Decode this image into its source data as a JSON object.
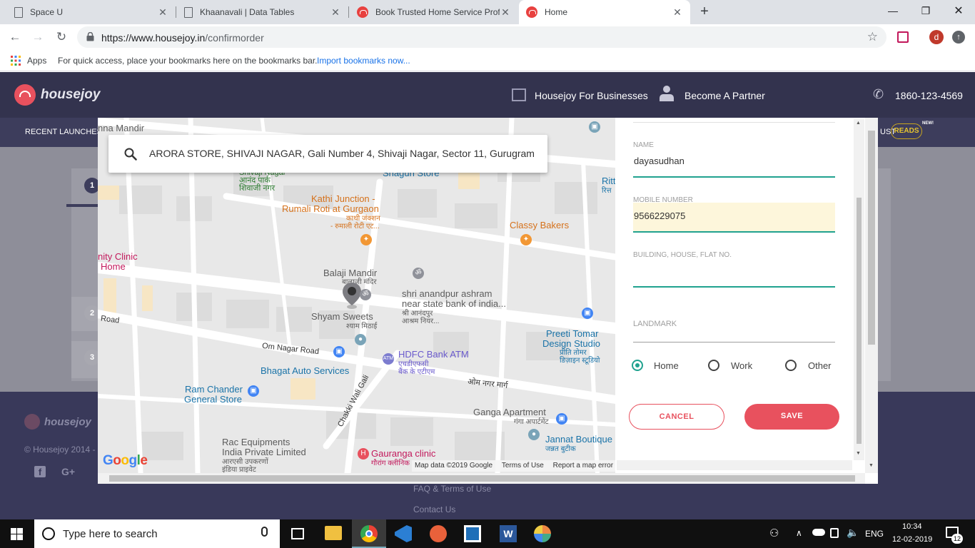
{
  "browser": {
    "tabs": [
      {
        "title": "Space U",
        "active": false
      },
      {
        "title": "Khaanavali | Data Tables",
        "active": false
      },
      {
        "title": "Book Trusted Home Service Profe",
        "active": false
      },
      {
        "title": "Home",
        "active": true
      }
    ],
    "url_host": "https://www.housejoy.in",
    "url_path": "/confirmorder",
    "profile_initial": "d",
    "bookmarks": {
      "apps_label": "Apps",
      "hint": "For quick access, place your bookmarks here on the bookmarks bar.",
      "import_link": "Import bookmarks now..."
    }
  },
  "site": {
    "logo": "housejoy",
    "header": {
      "businesses": "Housejoy For Businesses",
      "partner": "Become A Partner",
      "phone": "1860-123-4569"
    },
    "subnav": {
      "recent": "RECENT LAUNCHES",
      "just": "UST",
      "reads": "READS",
      "new_badge": "NEW!"
    },
    "steps": [
      "1",
      "2",
      "3"
    ],
    "footer": {
      "copyright": "© Housejoy 2014 -",
      "faq": "FAQ & Terms of Use",
      "contact": "Contact Us"
    }
  },
  "map": {
    "search_value": "ARORA STORE, SHIVAJI NAGAR, Gali Number 4, Shivaji Nagar, Sector 11, Gurugram",
    "labels": {
      "nna_mandir": "nna Mandir",
      "shivaji_nagar": "Shivaji Nagar",
      "anand_park": "आनंद पार्क",
      "shivaji_nagar_hi": "शिवाजी नगर",
      "shagun_store": "Shagun Store",
      "ritt": "Ritt",
      "ritt_hi": "रित्त",
      "kathi_1": "Kathi Junction -",
      "kathi_2": "Rumali Roti at Gurgaon",
      "kathi_hi1": "काथी जंक्शन",
      "kathi_hi2": "- रुमाली रोटी एट...",
      "classy": "Classy Bakers",
      "clinic_1": "nity Clinic",
      "clinic_2": "Home",
      "balaji": "Balaji Mandir",
      "balaji_hi": "बालाजी मंदिर",
      "ashram_1": "shri anandpur ashram",
      "ashram_2": "near state bank of india...",
      "ashram_hi1": "श्री आनंदपुर",
      "ashram_hi2": "आश्रम नियर...",
      "shyam": "Shyam Sweets",
      "shyam_hi": "श्याम मिठाई",
      "road": "Road",
      "preeti_1": "Preeti Tomar",
      "preeti_2": "Design Studio",
      "preeti_hi1": "प्रीति तोमर",
      "preeti_hi2": "डिज़ाइन स्टूडियो",
      "om_nagar": "Om Nagar Road",
      "hdfc": "HDFC Bank ATM",
      "hdfc_hi1": "एचडीएफसी",
      "hdfc_hi2": "बैंक के एटीएम",
      "bhagat": "Bhagat Auto Services",
      "om_nagar_hi": "ओम नगर मार्ग",
      "chakki": "Chakki Wali Gali",
      "ram_1": "Ram Chander",
      "ram_2": "General Store",
      "ganga": "Ganga Apartment",
      "ganga_hi": "गंगा अपार्टमेंट",
      "jannat": "Jannat Boutique",
      "jannat_hi": "जन्नत बुटीक",
      "rac_1": "Rac Equipments",
      "rac_2": "India Private Limited",
      "rac_hi1": "आरएसी उपकरणों",
      "rac_hi2": "इंडिया प्राइवेट",
      "gauranga": "Gauranga clinic",
      "gauranga_hi": "गौरांग क्लीनिक"
    },
    "google": "Google",
    "attribution": "Map data ©2019 Google",
    "terms": "Terms of Use",
    "report": "Report a map error"
  },
  "form": {
    "name_label": "NAME",
    "name_value": "dayasudhan",
    "mobile_label": "MOBILE NUMBER",
    "mobile_value": "9566229075",
    "building_label": "BUILDING, HOUSE, FLAT NO.",
    "building_value": "",
    "landmark_label": "LANDMARK",
    "landmark_value": "",
    "address_types": [
      {
        "label": "Home",
        "selected": true
      },
      {
        "label": "Work",
        "selected": false
      },
      {
        "label": "Other",
        "selected": false
      }
    ],
    "cancel_label": "CANCEL",
    "save_label": "SAVE"
  },
  "taskbar": {
    "search_placeholder": "Type here to search",
    "language": "ENG",
    "time": "10:34",
    "date": "12-02-2019",
    "notification_count": "12"
  },
  "colors": {
    "accent_teal": "#20a28f",
    "brand_red": "#e8515e",
    "header_bg": "#33334e"
  }
}
